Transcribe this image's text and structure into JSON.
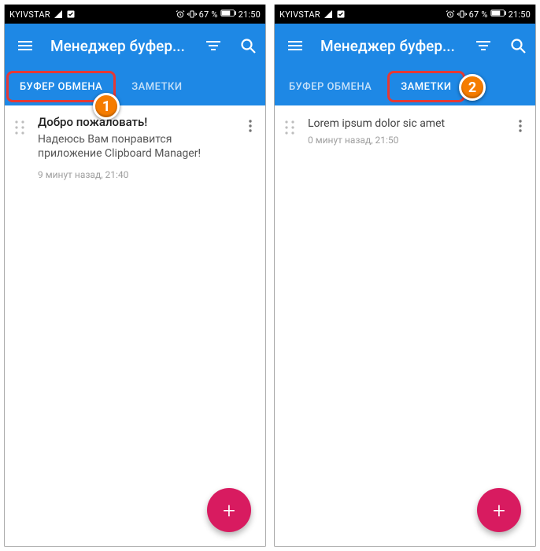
{
  "statusbar": {
    "carrier": "KYIVSTAR",
    "battery": "67 %",
    "clock": "21:50"
  },
  "appbar": {
    "title": "Менеджер буфер..."
  },
  "tabs": {
    "clipboard": "БУФЕР ОБМЕНА",
    "notes": "ЗАМЕТКИ"
  },
  "left_screen": {
    "item": {
      "title": "Добро пожаловать!",
      "text": "Надеюсь Вам понравится приложение Clipboard Manager!",
      "time": "9 минут назад, 21:40"
    },
    "callout": "1"
  },
  "right_screen": {
    "item": {
      "title": "Lorem ipsum dolor sic amet",
      "time": "0 минут назад, 21:50"
    },
    "callout": "2"
  },
  "fab": "+"
}
